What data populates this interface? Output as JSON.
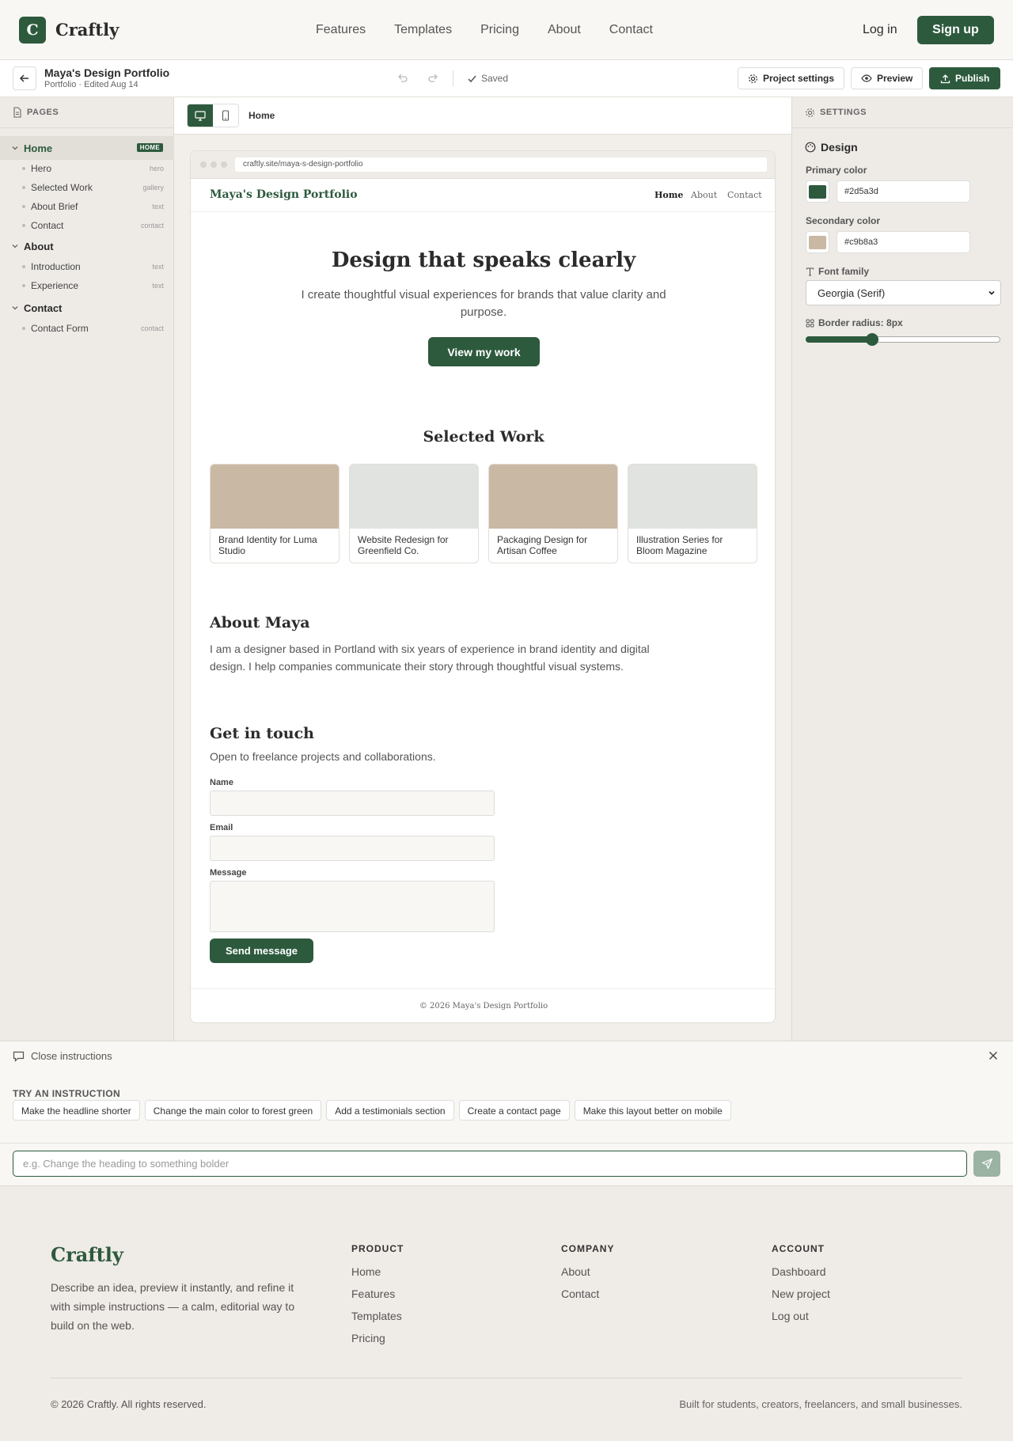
{
  "topnav": {
    "logo_letter": "C",
    "brand": "Craftly",
    "links": [
      "Features",
      "Templates",
      "Pricing",
      "About",
      "Contact"
    ],
    "login": "Log in",
    "signup": "Sign up"
  },
  "editor": {
    "project_name": "Maya's Design Portfolio",
    "project_meta": "Portfolio · Edited Aug 14",
    "saved": "Saved",
    "project_settings": "Project settings",
    "preview": "Preview",
    "publish": "Publish"
  },
  "pages": {
    "header": "PAGES",
    "home_badge": "HOME",
    "items": [
      {
        "label": "Home",
        "active": true,
        "sections": [
          {
            "name": "Hero",
            "type": "hero"
          },
          {
            "name": "Selected Work",
            "type": "gallery"
          },
          {
            "name": "About Brief",
            "type": "text"
          },
          {
            "name": "Contact",
            "type": "contact"
          }
        ]
      },
      {
        "label": "About",
        "active": false,
        "sections": [
          {
            "name": "Introduction",
            "type": "text"
          },
          {
            "name": "Experience",
            "type": "text"
          }
        ]
      },
      {
        "label": "Contact",
        "active": false,
        "sections": [
          {
            "name": "Contact Form",
            "type": "contact"
          }
        ]
      }
    ]
  },
  "canvas": {
    "breadcrumb": "Home",
    "url": "craftly.site/maya-s-design-portfolio"
  },
  "site": {
    "brand": "Maya's Design Portfolio",
    "nav": [
      "Home",
      "About",
      "Contact"
    ],
    "hero_title": "Design that speaks clearly",
    "hero_subtitle": "I create thoughtful visual experiences for brands that value clarity and purpose.",
    "hero_button": "View my work",
    "work_title": "Selected Work",
    "work": [
      {
        "title": "Brand Identity for Luma Studio",
        "color": "#c9b8a3"
      },
      {
        "title": "Website Redesign for Greenfield Co.",
        "color": "#e0e3e0"
      },
      {
        "title": "Packaging Design for Artisan Coffee",
        "color": "#c9b8a3"
      },
      {
        "title": "Illustration Series for Bloom Magazine",
        "color": "#e0e3e0"
      }
    ],
    "about_title": "About Maya",
    "about_text": "I am a designer based in Portland with six years of experience in brand identity and digital design. I help companies communicate their story through thoughtful visual systems.",
    "contact_title": "Get in touch",
    "contact_subtitle": "Open to freelance projects and collaborations.",
    "form": {
      "name_label": "Name",
      "email_label": "Email",
      "message_label": "Message",
      "send": "Send message"
    },
    "footer": "© 2026 Maya's Design Portfolio"
  },
  "settings": {
    "header": "SETTINGS",
    "design": "Design",
    "primary_label": "Primary color",
    "primary": "#2d5a3d",
    "secondary_label": "Secondary color",
    "secondary": "#c9b8a3",
    "font_label": "Font family",
    "font_value": "Georgia (Serif)",
    "radius_label": "Border radius: 8px",
    "radius_fraction": 0.34
  },
  "instructions": {
    "close": "Close instructions",
    "try": "TRY AN INSTRUCTION",
    "chips": [
      "Make the headline shorter",
      "Change the main color to forest green",
      "Add a testimonials section",
      "Create a contact page",
      "Make this layout better on mobile"
    ],
    "placeholder": "e.g. Change the heading to something bolder"
  },
  "footer": {
    "brand": "Craftly",
    "description": "Describe an idea, preview it instantly, and refine it with simple instructions — a calm, editorial way to build on the web.",
    "columns": [
      {
        "heading": "PRODUCT",
        "links": [
          "Home",
          "Features",
          "Templates",
          "Pricing"
        ]
      },
      {
        "heading": "COMPANY",
        "links": [
          "About",
          "Contact"
        ]
      },
      {
        "heading": "ACCOUNT",
        "links": [
          "Dashboard",
          "New project",
          "Log out"
        ]
      }
    ],
    "copyright": "© 2026 Craftly. All rights reserved.",
    "built": "Built for students, creators, freelancers, and small businesses."
  },
  "colors": {
    "accent": "#2d5a3d",
    "accent_muted": "#9ab3a2"
  }
}
